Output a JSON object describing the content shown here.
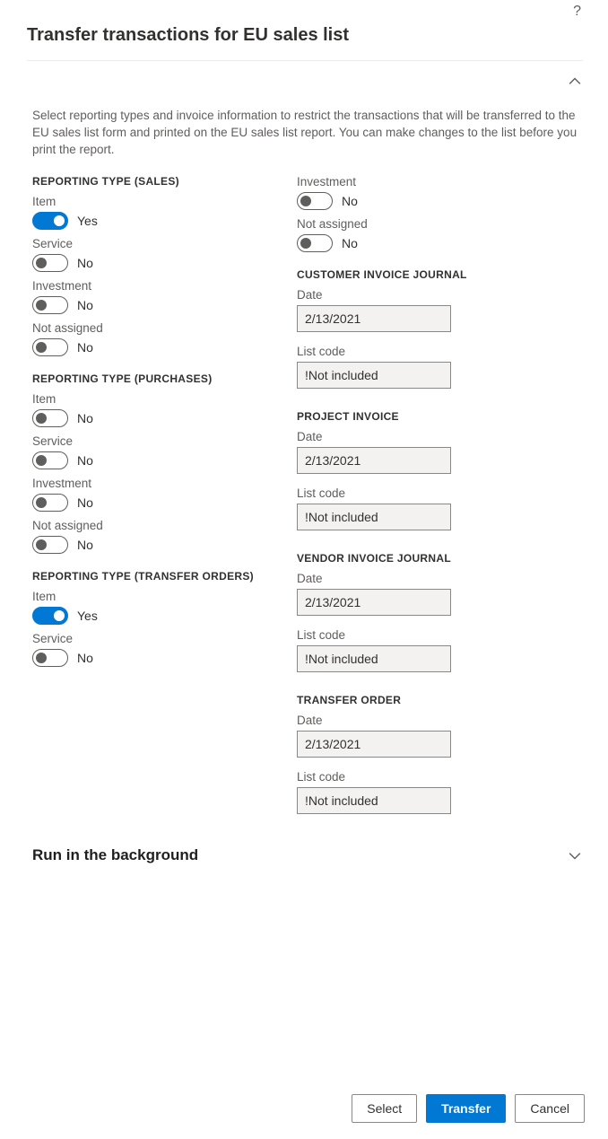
{
  "title": "Transfer transactions for EU sales list",
  "intro": "Select reporting types and invoice information to restrict the transactions that will be transferred to the EU sales list form and printed on the EU sales list report. You can make changes to the list before you print the report.",
  "labels": {
    "yes": "Yes",
    "no": "No",
    "date": "Date",
    "list_code": "List code"
  },
  "sections": {
    "sales": {
      "header": "REPORTING TYPE (SALES)",
      "item": {
        "label": "Item",
        "on": true
      },
      "service": {
        "label": "Service",
        "on": false
      },
      "investment": {
        "label": "Investment",
        "on": false
      },
      "not_assigned": {
        "label": "Not assigned",
        "on": false
      }
    },
    "purchases": {
      "header": "REPORTING TYPE (PURCHASES)",
      "item": {
        "label": "Item",
        "on": false
      },
      "service": {
        "label": "Service",
        "on": false
      },
      "investment": {
        "label": "Investment",
        "on": false
      },
      "not_assigned": {
        "label": "Not assigned",
        "on": false
      }
    },
    "transfer_orders": {
      "header": "REPORTING TYPE (TRANSFER ORDERS)",
      "item": {
        "label": "Item",
        "on": true
      },
      "service": {
        "label": "Service",
        "on": false
      },
      "investment": {
        "label": "Investment",
        "on": false
      },
      "not_assigned": {
        "label": "Not assigned",
        "on": false
      }
    },
    "cust_invoice": {
      "header": "CUSTOMER INVOICE JOURNAL",
      "date": "2/13/2021",
      "list_code": "!Not included"
    },
    "proj_invoice": {
      "header": "PROJECT INVOICE",
      "date": "2/13/2021",
      "list_code": "!Not included"
    },
    "vend_invoice": {
      "header": "VENDOR INVOICE JOURNAL",
      "date": "2/13/2021",
      "list_code": "!Not included"
    },
    "transfer_order": {
      "header": "TRANSFER ORDER",
      "date": "2/13/2021",
      "list_code": "!Not included"
    }
  },
  "background_section": "Run in the background",
  "buttons": {
    "select": "Select",
    "transfer": "Transfer",
    "cancel": "Cancel"
  }
}
